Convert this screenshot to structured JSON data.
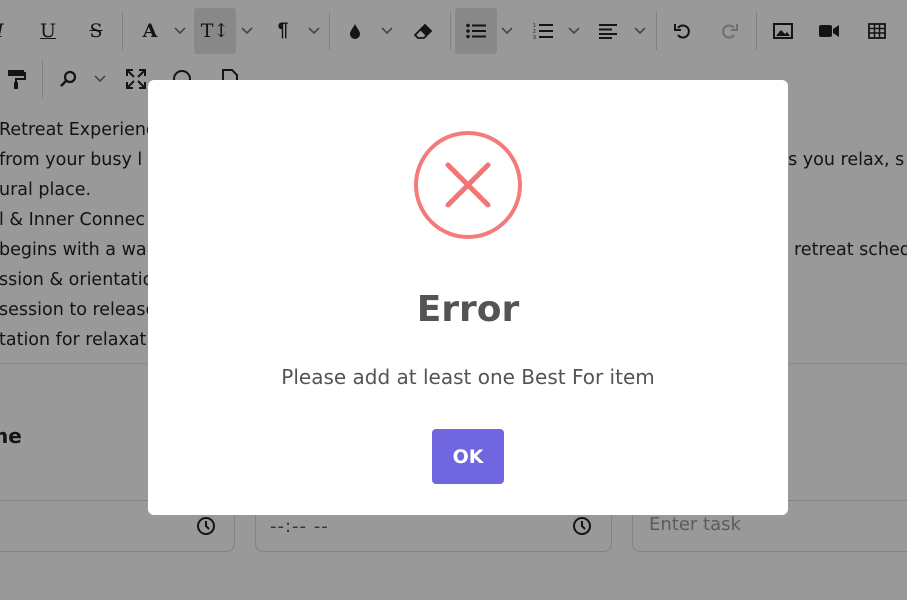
{
  "toolbar": {
    "row1": [
      {
        "icon": "italic-icon",
        "glyph": "I"
      },
      {
        "icon": "underline-icon",
        "glyph": "U"
      },
      {
        "icon": "strikethrough-icon",
        "glyph": "S"
      },
      {
        "icon": "font-color-icon",
        "glyph": "A"
      },
      {
        "icon": "font-size-icon",
        "glyph": "T↕"
      },
      {
        "icon": "paragraph-icon",
        "glyph": "¶"
      },
      {
        "icon": "highlight-drop-icon"
      },
      {
        "icon": "eraser-icon"
      },
      {
        "icon": "bullet-list-icon"
      },
      {
        "icon": "numbered-list-icon"
      },
      {
        "icon": "align-icon"
      },
      {
        "icon": "undo-icon"
      },
      {
        "icon": "redo-icon"
      },
      {
        "icon": "image-icon"
      },
      {
        "icon": "video-icon"
      },
      {
        "icon": "table-icon"
      }
    ],
    "row2": [
      {
        "icon": "format-painter-icon"
      },
      {
        "icon": "find-icon"
      },
      {
        "icon": "fullscreen-icon"
      },
      {
        "icon": "preview-icon"
      },
      {
        "icon": "document-icon"
      }
    ]
  },
  "editor": {
    "lines": [
      "Retreat Experienc",
      " from your busy l",
      "ural place.",
      "l & Inner Connec",
      " begins with a wa",
      "ssion & orientatio",
      "session to release",
      "tation for relaxat"
    ],
    "lines_right": [
      "ps you relax, s",
      " retreat sched"
    ]
  },
  "form": {
    "section_label": "ne",
    "time_value": "--:-- --",
    "task_placeholder": "Enter task"
  },
  "modal": {
    "title": "Error",
    "message": "Please add at least one Best For item",
    "ok_label": "OK",
    "accent": "#f27474",
    "button_color": "#7066e0"
  }
}
